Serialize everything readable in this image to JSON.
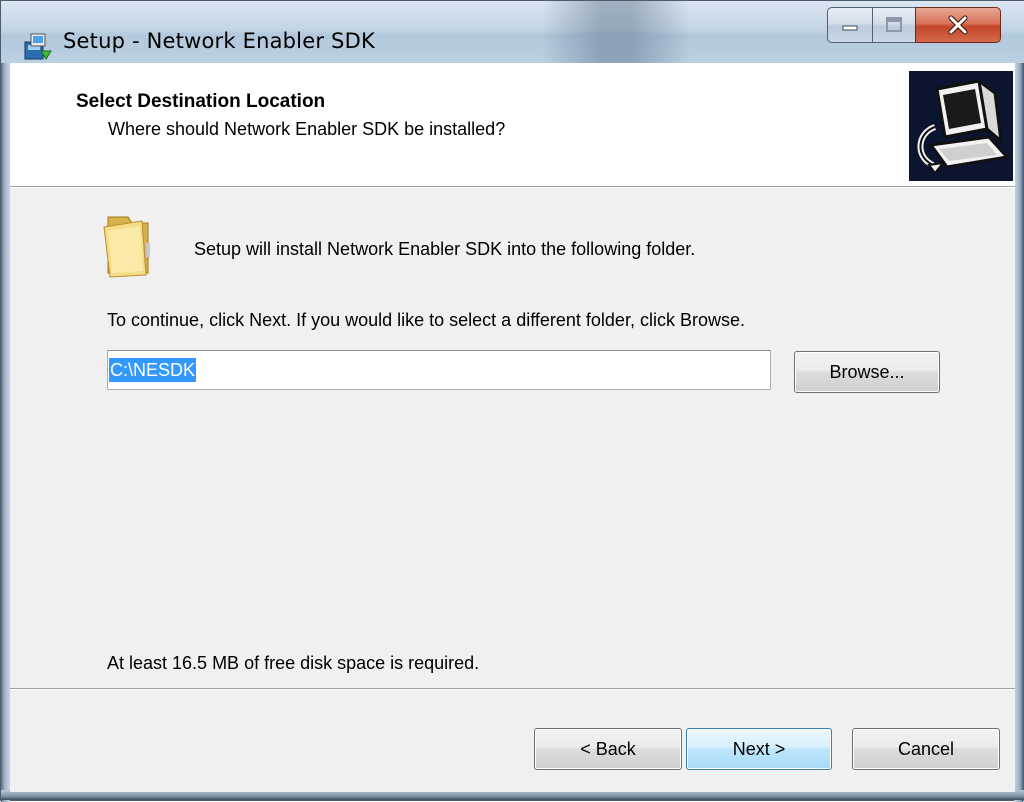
{
  "window": {
    "title": "Setup - Network Enabler SDK",
    "controls": {
      "minimize_icon": "minimize-icon",
      "maximize_icon": "maximize-icon",
      "close_icon": "close-icon"
    }
  },
  "header": {
    "title": "Select Destination Location",
    "subtitle": "Where should Network Enabler SDK be installed?"
  },
  "body": {
    "intro": "Setup will install Network Enabler SDK into the following folder.",
    "instructions": "To continue, click Next. If you would like to select a different folder, click Browse.",
    "path_value": "C:\\NESDK",
    "browse_label": "Browse...",
    "disk_space": "At least 16.5 MB of free disk space is required."
  },
  "footer": {
    "back_label": "< Back",
    "next_label": "Next >",
    "cancel_label": "Cancel"
  },
  "colors": {
    "selection": "#3399ff",
    "header_icon_bg": "#0c1530",
    "close_button": "#c2452a"
  }
}
